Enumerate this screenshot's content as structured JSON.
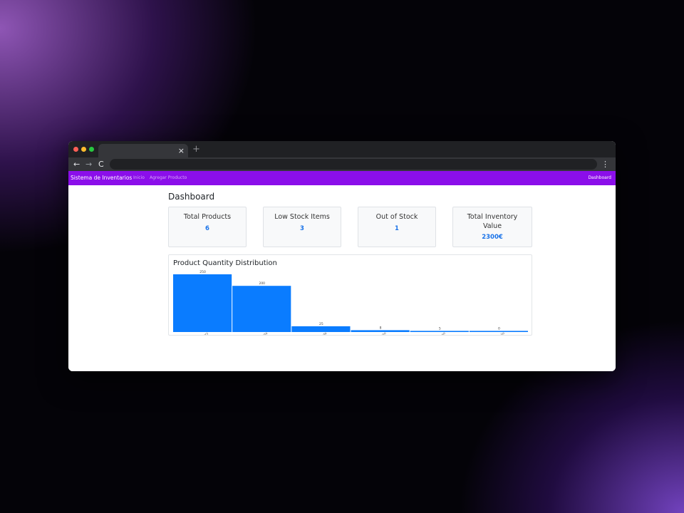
{
  "browser": {
    "tab_close": "×",
    "new_tab": "+",
    "back": "←",
    "forward": "→",
    "reload": "C",
    "menu": "⋮"
  },
  "navbar": {
    "brand": "Sistema de Inventarios",
    "links": [
      "Inicio",
      "Agregar Producto"
    ],
    "right_link": "Dashboard",
    "color": "#8b0eea"
  },
  "dashboard": {
    "title": "Dashboard",
    "cards": [
      {
        "title": "Total Products",
        "value": "6"
      },
      {
        "title": "Low Stock Items",
        "value": "3"
      },
      {
        "title": "Out of Stock",
        "value": "1"
      },
      {
        "title": "Total Inventory Value",
        "value": "2300€"
      }
    ]
  },
  "chart_data": {
    "type": "bar",
    "title": "Product Quantity Distribution",
    "categories": [
      "Tomate Cherry",
      "Pera Amarilla",
      "Carne Asada",
      "Vino Tinto",
      "Queso",
      "Pollo"
    ],
    "values": [
      250,
      200,
      25,
      8,
      5,
      0
    ],
    "ylim": [
      0,
      250
    ],
    "bar_color": "#0a7cff",
    "grid": false
  }
}
